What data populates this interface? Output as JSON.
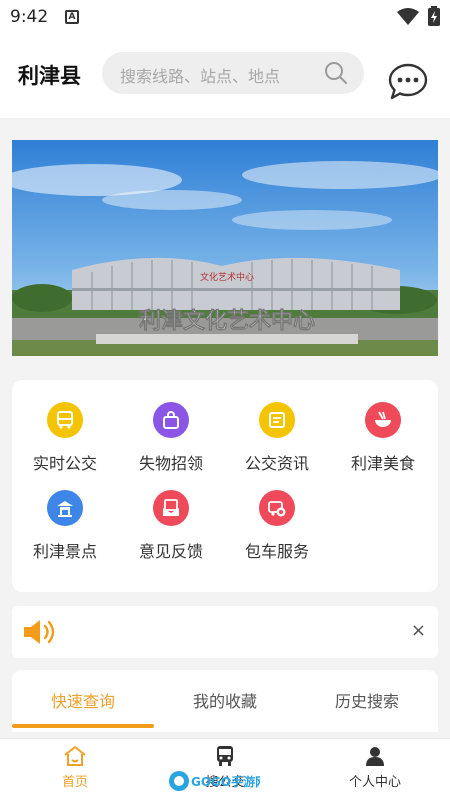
{
  "status": {
    "time": "9:42",
    "notif_glyph": "A"
  },
  "header": {
    "city": "利津县",
    "search_placeholder": "搜索线路、站点、地点"
  },
  "banner": {
    "building_sign": "利津文化艺术中心",
    "top_sign": "文化艺术中心"
  },
  "features": [
    {
      "label": "实时公交",
      "icon": "bus-icon",
      "color": "#f5c400"
    },
    {
      "label": "失物招领",
      "icon": "bag-icon",
      "color": "#8b56e6"
    },
    {
      "label": "公交资讯",
      "icon": "news-icon",
      "color": "#f5c400"
    },
    {
      "label": "利津美食",
      "icon": "food-icon",
      "color": "#ee4a5a"
    },
    {
      "label": "利津景点",
      "icon": "scenic-icon",
      "color": "#3d86e8"
    },
    {
      "label": "意见反馈",
      "icon": "feedback-icon",
      "color": "#ee4a5a"
    },
    {
      "label": "包车服务",
      "icon": "charter-icon",
      "color": "#ee4a5a"
    }
  ],
  "notice": {
    "close": "×"
  },
  "tabs": [
    {
      "label": "快速查询"
    },
    {
      "label": "我的收藏"
    },
    {
      "label": "历史搜索"
    }
  ],
  "nav": [
    {
      "label": "首页"
    },
    {
      "label": "搜公交"
    },
    {
      "label": "个人中心"
    }
  ],
  "watermark": {
    "text": "GOGO手游网"
  },
  "colors": {
    "accent": "#f0a12b",
    "background": "#f3f3f3"
  }
}
